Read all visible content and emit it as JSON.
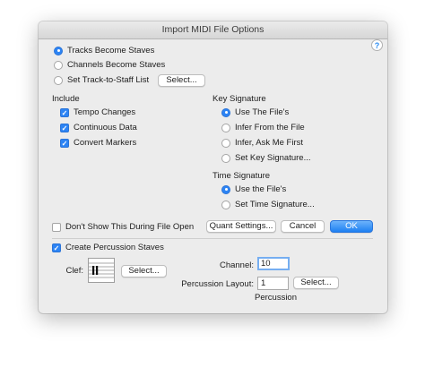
{
  "dialog": {
    "title": "Import MIDI File Options",
    "help": "?"
  },
  "staves": {
    "tracks": "Tracks Become Staves",
    "channels": "Channels Become Staves",
    "set_list": "Set Track-to-Staff List",
    "select": "Select..."
  },
  "include": {
    "heading": "Include",
    "items": [
      "Tempo Changes",
      "Continuous Data",
      "Convert Markers"
    ]
  },
  "key_signature": {
    "heading": "Key Signature",
    "items": [
      "Use The File's",
      "Infer From the File",
      "Infer, Ask Me First",
      "Set Key Signature..."
    ]
  },
  "time_signature": {
    "heading": "Time Signature",
    "items": [
      "Use the File's",
      "Set Time Signature..."
    ]
  },
  "footer": {
    "dont_show": "Don't Show This During File Open",
    "quant": "Quant Settings...",
    "cancel": "Cancel",
    "ok": "OK"
  },
  "percussion": {
    "create": "Create Percussion Staves",
    "clef_label": "Clef:",
    "clef_select": "Select...",
    "channel_label": "Channel:",
    "channel_value": "10",
    "layout_label": "Percussion Layout:",
    "layout_value": "1",
    "layout_select": "Select...",
    "layout_name": "Percussion"
  }
}
